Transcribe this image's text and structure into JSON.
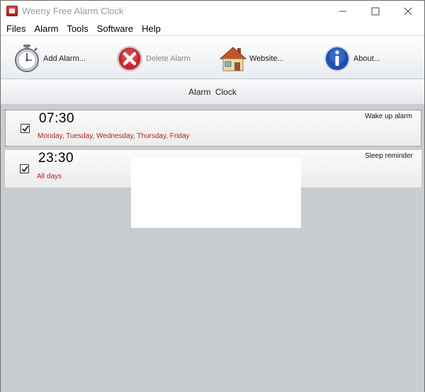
{
  "window": {
    "title": "Weeny Free Alarm Clock"
  },
  "menu": [
    "Files",
    "Alarm",
    "Tools",
    "Software",
    "Help"
  ],
  "toolbar": {
    "add_label": "Add Alarm...",
    "delete_label": "Delete Alarm",
    "website_label": "Website...",
    "about_label": "About..."
  },
  "header": {
    "title": "Alarm Clock"
  },
  "alarms": [
    {
      "time": "07:30",
      "days": "Monday, Tuesday, Wednesday, Thursday, Friday",
      "name": "Wake up alarm",
      "enabled": true
    },
    {
      "time": "23:30",
      "days": "All days",
      "name": "Sleep reminder",
      "enabled": true
    }
  ],
  "colors": {
    "days_text": "#b02020",
    "list_background": "#c9ccd0"
  },
  "icons": [
    "app-icon",
    "stopwatch-icon",
    "delete-icon",
    "house-icon",
    "info-icon",
    "minimize-icon",
    "maximize-icon",
    "close-icon",
    "checkmark-icon"
  ]
}
